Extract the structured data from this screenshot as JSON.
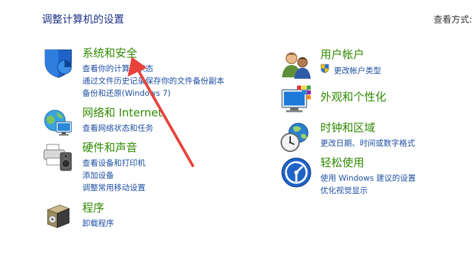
{
  "page": {
    "title": "调整计算机的设置",
    "view_by_label": "查看方式:"
  },
  "categories": [
    {
      "title": "系统和安全",
      "links": [
        "查看你的计算机状态",
        "通过文件历史记录保存你的文件备份副本",
        "备份和还原(Windows 7)"
      ],
      "icon": "system-security-shield-icon"
    },
    {
      "title": "网络和 Internet",
      "links": [
        "查看网络状态和任务"
      ],
      "icon": "network-globe-icon"
    },
    {
      "title": "硬件和声音",
      "links": [
        "查看设备和打印机",
        "添加设备",
        "调整常用移动设置"
      ],
      "icon": "hardware-printer-speaker-icon"
    },
    {
      "title": "程序",
      "links": [
        "卸载程序"
      ],
      "icon": "programs-box-icon"
    },
    {
      "title": "用户帐户",
      "links": [
        "更改帐户类型"
      ],
      "icon": "user-accounts-icon"
    },
    {
      "title": "外观和个性化",
      "links": [],
      "icon": "appearance-monitor-icon"
    },
    {
      "title": "时钟和区域",
      "links": [
        "更改日期、时间或数字格式"
      ],
      "icon": "clock-globe-icon"
    },
    {
      "title": "轻松使用",
      "links": [
        "使用 Windows 建议的设置",
        "优化视觉显示"
      ],
      "icon": "ease-of-access-icon"
    }
  ],
  "colors": {
    "category_title": "#2f8a00",
    "link": "#1e4fa3",
    "page_title": "#1e3287",
    "annotation_arrow": "#e8433b"
  }
}
